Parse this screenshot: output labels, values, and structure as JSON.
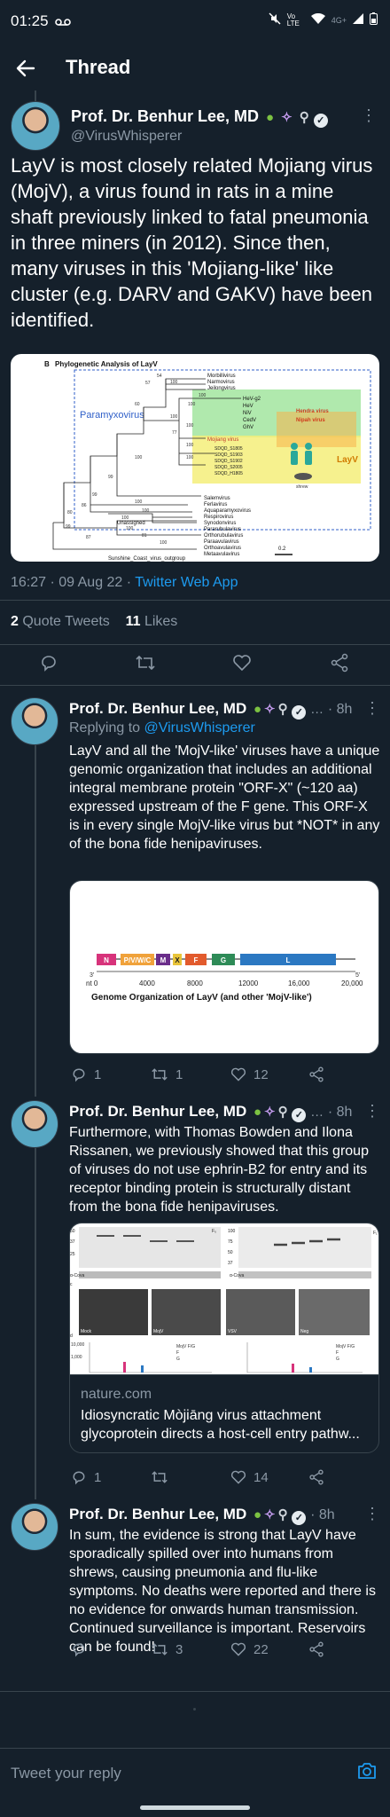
{
  "status_bar": {
    "time": "01:25",
    "network": "Vo LTE",
    "signal": "4G+"
  },
  "header": {
    "title": "Thread"
  },
  "main_tweet": {
    "author": "Prof. Dr. Benhur Lee, MD",
    "handle": "@VirusWhisperer",
    "text": "LayV is most closely related Mojiang virus (MojV), a virus found in rats in a mine shaft previously linked to fatal pneumonia in three miners (in 2012). Since then, many viruses in this 'Mojiang-like' like cluster (e.g. DARV and GAKV) have been identified.",
    "image": {
      "panel_label": "B",
      "title": "Phylogenetic Analysis of LayV",
      "group_label": "Paramyxovirus",
      "taxa": [
        "Morbillivirus",
        "Narmovirus",
        "Jeilongvirus",
        "HeV-g2",
        "HeV",
        "NiV",
        "CedV",
        "GhV",
        "Mojiang virus",
        "Salemvirus",
        "Ferlavirus",
        "Aquaparamyxovirus",
        "Respirovirus",
        "Synodonvirus",
        "Pararubulavirus",
        "Orthorubulavirus",
        "Paraavulavirus",
        "Orthoavulavirus",
        "Metaavulavirus",
        "Sunshine_Coast_virus_outgroup"
      ],
      "highlight_labels": [
        "Hendra virus",
        "Nipah virus",
        "LayV",
        "shrew"
      ],
      "layv_samples": [
        "SDQD_S1805",
        "SDQD_S1903",
        "SDQD_S1902",
        "SDQD_S2005",
        "SDQD_H1805"
      ],
      "unassigned": "Unassigned",
      "scale": "0.2",
      "bootstrap": [
        "54",
        "57",
        "100",
        "100",
        "100",
        "60",
        "100",
        "100",
        "77",
        "100",
        "100",
        "100",
        "99",
        "99",
        "86",
        "80",
        "99",
        "87",
        "100",
        "100",
        "100",
        "100",
        "81",
        "100"
      ]
    },
    "timestamp": "16:27 · 09 Aug 22 · ",
    "source": "Twitter Web App",
    "quote_count": "2",
    "quote_label": "Quote Tweets",
    "like_count": "11",
    "like_label": "Likes"
  },
  "replies": [
    {
      "author": "Prof. Dr. Benhur Lee, MD",
      "time": "· 8h",
      "replying_prefix": "Replying to ",
      "replying_to": "@VirusWhisperer",
      "text": "LayV and all the 'MojV-like' viruses have a unique genomic organization that includes an additional integral membrane protein \"ORF-X\" (~120 aa) expressed upstream of the F gene. This ORF-X is in every single MojV-like virus but *NOT* in any of the bona fide henipaviruses.",
      "genome": {
        "genes": [
          "N",
          "P/V/W/C",
          "M",
          "X",
          "F",
          "G",
          "L"
        ],
        "axis_ticks": [
          "nt 0",
          "4000",
          "8000",
          "12000",
          "16,000",
          "20,000"
        ],
        "end_3": "3'",
        "end_5": "5'",
        "caption": "Genome  Organization  of  LayV (and other 'MojV-like')"
      },
      "replies": "1",
      "retweets": "1",
      "likes": "12"
    },
    {
      "author": "Prof. Dr. Benhur Lee, MD",
      "time": "· 8h",
      "text": "Furthermore, with Thomas Bowden and Ilona Rissanen, we previously showed that this group of viruses do not use ephrin-B2 for entry and its receptor binding protein is structurally distant from the bona fide henipaviruses.",
      "link_card": {
        "blot_labels": [
          "F₀",
          "F₁",
          "α-Cova",
          "c",
          "d"
        ],
        "mw_left": [
          "50",
          "37",
          "25"
        ],
        "mw_right": [
          "100",
          "75",
          "50",
          "37"
        ],
        "micro_labels": [
          "Mock",
          "MojV",
          "VSV",
          "Neg"
        ],
        "plot_y_labels": [
          "10,000",
          "1,000"
        ],
        "legend": [
          "MojV F/G",
          "F",
          "G"
        ],
        "domain": "nature.com",
        "title": "Idiosyncratic Mòjiāng virus attachment glycoprotein directs a host-cell entry pathw..."
      },
      "replies": "1",
      "retweets": "",
      "likes": "14"
    },
    {
      "author": "Prof. Dr. Benhur Lee, MD",
      "time": "· 8h",
      "text": "In sum, the evidence is strong that LayV have sporadically spilled over into humans from shrews, causing pneumonia and flu-like symptoms. No deaths were reported and there is no evidence for onwards human transmission. Continued surveillance is important. Reservoirs can be found!",
      "replies": "",
      "retweets": "3",
      "likes": "22"
    }
  ],
  "composer": {
    "placeholder": "Tweet your reply"
  },
  "colors": {
    "background": "#15202b",
    "accent": "#1d9bf0",
    "muted": "#8b98a5",
    "divider": "#38444d"
  }
}
